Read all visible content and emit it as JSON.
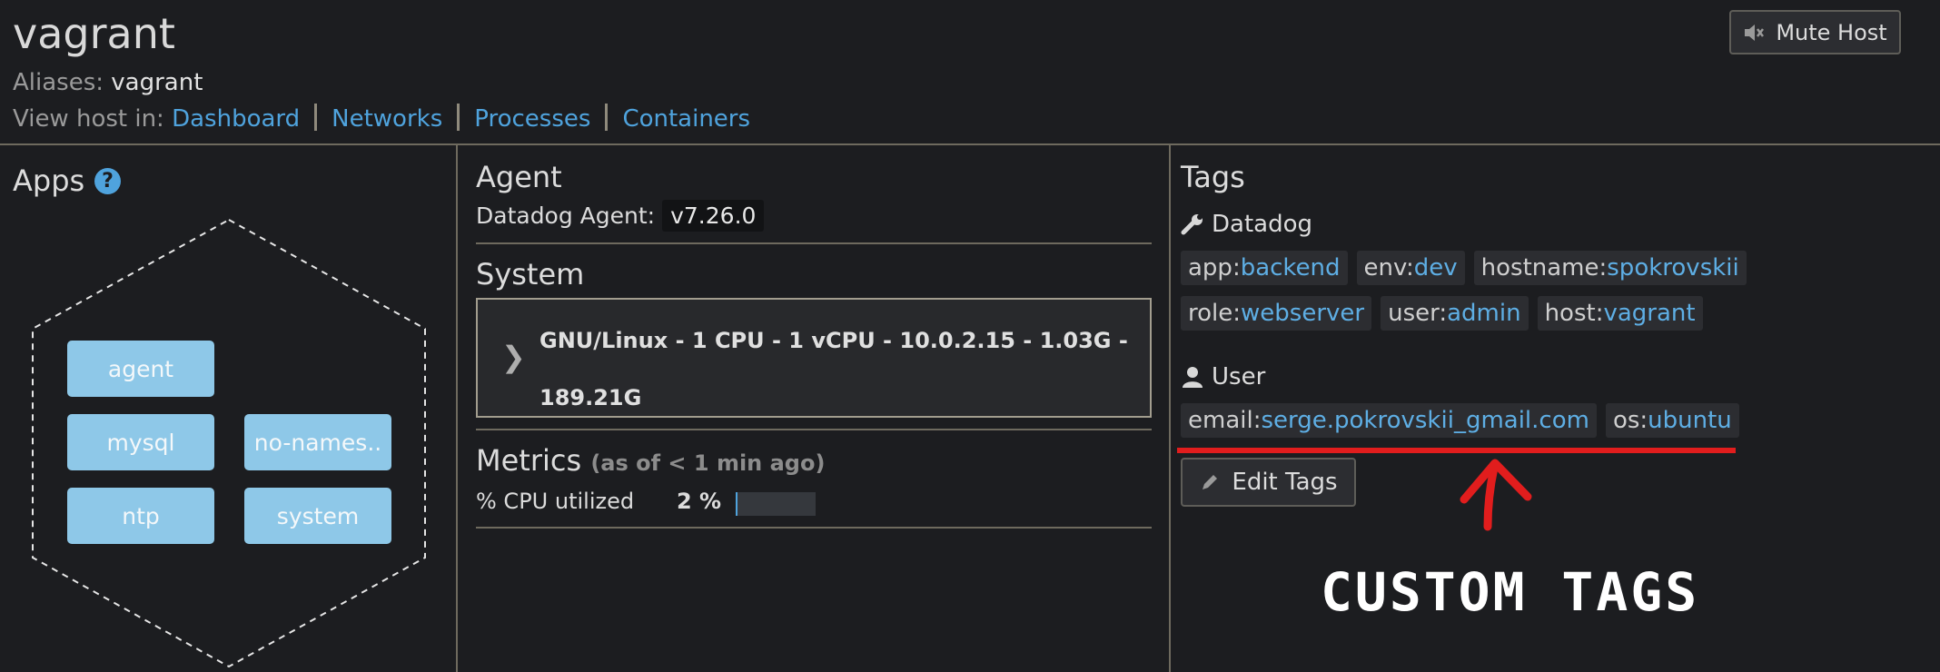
{
  "header": {
    "host_name": "vagrant",
    "aliases_label": "Aliases:",
    "aliases_value": "vagrant",
    "view_host_label": "View host in:",
    "links": [
      "Dashboard",
      "Networks",
      "Processes",
      "Containers"
    ],
    "mute_button": "Mute Host",
    "mute_icon": "speaker-mute-icon"
  },
  "apps": {
    "title": "Apps",
    "help_icon": "question-circle-icon",
    "items": [
      "agent",
      "mysql",
      "no-names..",
      "ntp",
      "system"
    ],
    "tile_color": "#8ec8e8"
  },
  "agent": {
    "title": "Agent",
    "label": "Datadog Agent:",
    "version": "v7.26.0"
  },
  "system": {
    "title": "System",
    "spec": "GNU/Linux - 1 CPU - 1 vCPU - 10.0.2.15 - 1.03G - 189.21G",
    "chevron_icon": "chevron-right-icon"
  },
  "metrics": {
    "title": "Metrics",
    "as_of": "(as of < 1 min ago)",
    "cpu_label": "% CPU utilized",
    "cpu_value": "2 %",
    "cpu_fraction": 0.02
  },
  "tags": {
    "title": "Tags",
    "datadog_group": {
      "label": "Datadog",
      "icon": "wrench-icon",
      "rows": [
        [
          {
            "k": "app:",
            "v": "backend"
          },
          {
            "k": "env:",
            "v": "dev"
          },
          {
            "k": "hostname:",
            "v": "spokrovskii"
          }
        ],
        [
          {
            "k": "role:",
            "v": "webserver"
          },
          {
            "k": "user:",
            "v": "admin"
          },
          {
            "k": "host:",
            "v": "vagrant"
          }
        ]
      ]
    },
    "user_group": {
      "label": "User",
      "icon": "user-icon",
      "rows": [
        [
          {
            "k": "email:",
            "v": "serge.pokrovskii_gmail.com"
          },
          {
            "k": "os:",
            "v": "ubuntu"
          }
        ]
      ]
    },
    "edit_button": "Edit Tags",
    "edit_icon": "pencil-icon"
  },
  "annotation": {
    "text": "CUSTOM TAGS",
    "color": "#e11d1d"
  },
  "colors": {
    "background": "#1c1d20",
    "link": "#4fa3dd",
    "tag_value": "#5eaee4"
  }
}
